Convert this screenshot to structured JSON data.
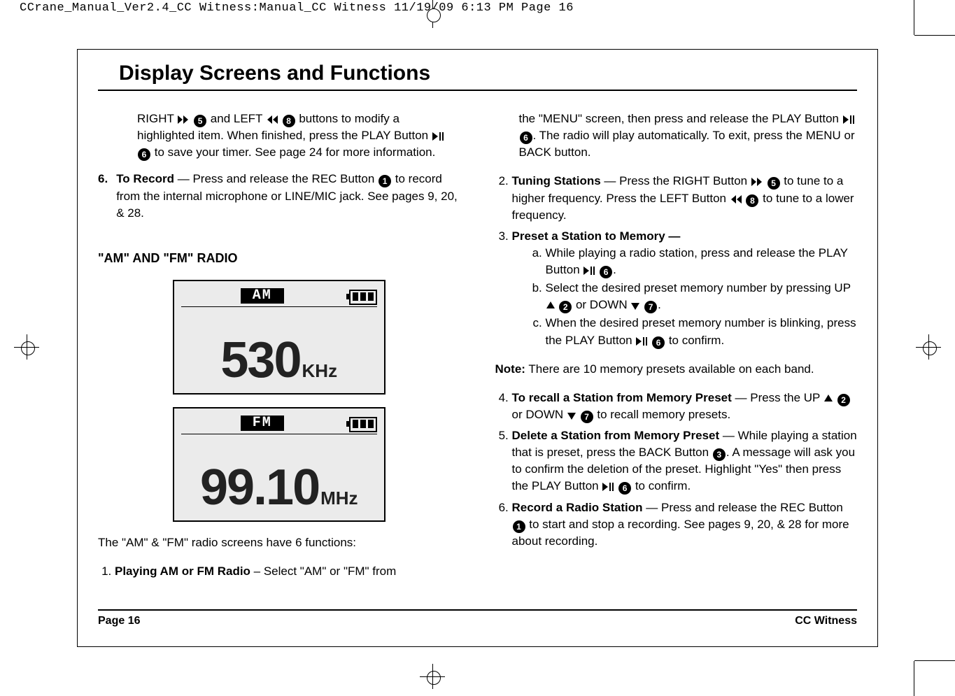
{
  "header": "CCrane_Manual_Ver2.4_CC Witness:Manual_CC Witness  11/19/09  6:13 PM  Page 16",
  "title": "Display Screens and Functions",
  "left": {
    "prev_line1": "RIGHT",
    "prev_line2": "and LEFT",
    "prev_line3": "buttons to modify a highlighted item. When finished, press the PLAY Button",
    "prev_line4": "to save your timer. See page 24 for more information.",
    "item6_num": "6.",
    "item6_title": "To Record",
    "item6_body": " — Press and release the REC Button ",
    "item6_tail": " to record from the internal microphone or LINE/MIC jack. See pages 9, 20, & 28.",
    "subhead": "\"AM\" AND \"FM\" RADIO",
    "am_label": "AM",
    "am_freq": "530",
    "am_unit": "KHz",
    "fm_label": "FM",
    "fm_freq": "99.10",
    "fm_unit": "MHz",
    "intro": "The \"AM\" & \"FM\" radio screens have 6 functions:",
    "li1_title": "Playing AM or FM Radio",
    "li1_body": " – Select \"AM\" or \"FM\" from"
  },
  "right": {
    "cont1": "the \"MENU\" screen, then press and release the PLAY Button ",
    "cont2": ". The radio will play automatically. To exit, press the MENU or BACK button.",
    "li2_title": "Tuning Stations",
    "li2_a": " — Press the RIGHT Button ",
    "li2_b": " to tune to a higher frequency. Press the LEFT Button ",
    "li2_c": " to tune to a lower frequency.",
    "li3_title": "Preset a Station to Memory —",
    "li3a": "While playing a radio station, press and release the PLAY Button ",
    "li3b": "Select the desired preset memory number by pressing UP ",
    "li3b2": " or DOWN ",
    "li3c": "When the desired preset memory number is blinking, press the PLAY Button ",
    "li3c2": " to confirm.",
    "note_label": "Note:",
    "note_body": " There are 10 memory presets available on each band.",
    "li4_title": "To recall a Station from Memory Preset",
    "li4_a": " — Press the UP ",
    "li4_b": " or DOWN ",
    "li4_c": " to recall memory presets.",
    "li5_title": "Delete a Station from Memory Preset",
    "li5_a": " — While playing a station that is preset, press the BACK Button ",
    "li5_b": ". A message will ask you to confirm the deletion of the preset. Highlight \"Yes\" then press the PLAY Button ",
    "li5_c": " to confirm.",
    "li6_title": "Record a Radio Station",
    "li6_a": " — Press and release the REC Button ",
    "li6_b": " to start and stop a recording. See pages 9, 20, & 28 for more about recording."
  },
  "footer": {
    "left": "Page 16",
    "right": "CC Witness"
  },
  "buttons": {
    "b1": "1",
    "b2": "2",
    "b3": "3",
    "b5": "5",
    "b6": "6",
    "b7": "7",
    "b8": "8"
  }
}
